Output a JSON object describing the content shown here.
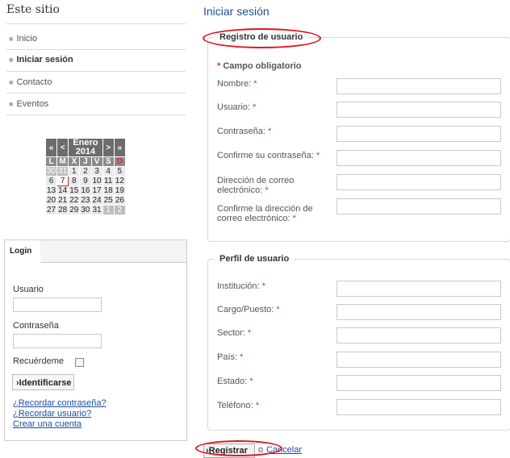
{
  "sidebar": {
    "title": "Este sitio",
    "items": [
      {
        "label": "Inicio"
      },
      {
        "label": "Iniciar sesión"
      },
      {
        "label": "Contacto"
      },
      {
        "label": "Eventos"
      }
    ]
  },
  "calendar": {
    "prev_year": "«",
    "prev_month": "<",
    "month_label": "Enero 2014",
    "next_month": ">",
    "next_year": "»",
    "weekdays": [
      "L",
      "M",
      "X",
      "J",
      "V",
      "S",
      "D"
    ],
    "weeks": [
      [
        "30",
        "31",
        "1",
        "2",
        "3",
        "4",
        "5"
      ],
      [
        "6",
        "7",
        "8",
        "9",
        "10",
        "11",
        "12"
      ],
      [
        "13",
        "14",
        "15",
        "16",
        "17",
        "18",
        "19"
      ],
      [
        "20",
        "21",
        "22",
        "23",
        "24",
        "25",
        "26"
      ],
      [
        "27",
        "28",
        "29",
        "30",
        "31",
        "1",
        "2"
      ]
    ],
    "today": "7"
  },
  "login": {
    "tab_label": "Login",
    "username_label": "Usuario",
    "password_label": "Contraseña",
    "remember_label": "Recuérdeme",
    "submit_label": "›Identificarse",
    "links": [
      "¿Recordar contraseña?",
      "¿Recordar usuario?",
      "Crear una cuenta"
    ]
  },
  "main": {
    "title": "Iniciar sesión",
    "registration": {
      "legend": "Registro de usuario",
      "required_note": "Campo obligatorio",
      "required_mark": "*",
      "fields": [
        {
          "label": "Nombre:",
          "value": ""
        },
        {
          "label": "Usuario:",
          "value": ""
        },
        {
          "label": "Contraseña:",
          "value": ""
        },
        {
          "label": "Confirme su contraseña:",
          "value": ""
        },
        {
          "label": "Dirección de correo electrónico:",
          "value": ""
        },
        {
          "label": "Confirme la dirección de correo electrónico:",
          "value": ""
        }
      ]
    },
    "profile": {
      "legend": "Perfil de usuario",
      "fields": [
        {
          "label": "Institución:",
          "value": ""
        },
        {
          "label": "Cargo/Puesto:",
          "value": ""
        },
        {
          "label": "Sector:",
          "value": ""
        },
        {
          "label": "País:",
          "value": ""
        },
        {
          "label": "Estado:",
          "value": ""
        },
        {
          "label": "Teléfono:",
          "value": ""
        }
      ]
    },
    "register_label": "›Registrar",
    "or_label": "o",
    "cancel_label": "Cancelar"
  },
  "colors": {
    "title_blue": "#1d4f8c",
    "link_blue": "#1a4ea0",
    "required_red": "#d33333",
    "annotation_red": "#e0141e"
  }
}
